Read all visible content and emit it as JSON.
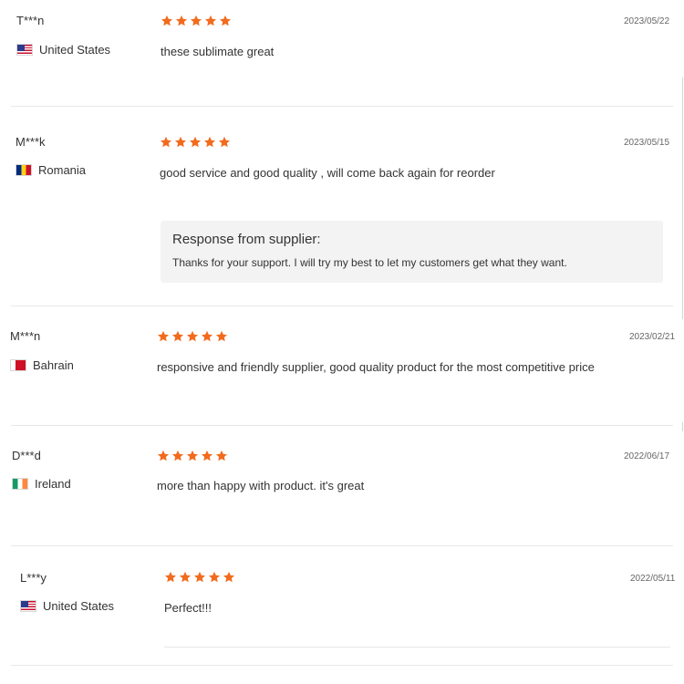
{
  "star_color": "#f26b1d",
  "reviews": [
    {
      "name": "T***n",
      "country": "United States",
      "flag_icon": "us-flag-icon",
      "rating": 5,
      "date": "2023/05/22",
      "comment": "these sublimate great"
    },
    {
      "name": "M***k",
      "country": "Romania",
      "flag_icon": "romania-flag-icon",
      "rating": 5,
      "date": "2023/05/15",
      "comment": "good service and good quality , will come back again for reorder",
      "response": {
        "title": "Response from supplier:",
        "text": "Thanks for your support. I will try my best to let my customers get what they want."
      }
    },
    {
      "name": "M***n",
      "country": "Bahrain",
      "flag_icon": "bahrain-flag-icon",
      "rating": 5,
      "date": "2023/02/21",
      "comment": "responsive and friendly supplier, good quality product for the most competitive price"
    },
    {
      "name": "D***d",
      "country": "Ireland",
      "flag_icon": "ireland-flag-icon",
      "rating": 5,
      "date": "2022/06/17",
      "comment": "more than happy with product. it's great"
    },
    {
      "name": "L***y",
      "country": "United States",
      "flag_icon": "us-flag-icon",
      "rating": 5,
      "date": "2022/05/11",
      "comment": "Perfect!!!"
    }
  ]
}
